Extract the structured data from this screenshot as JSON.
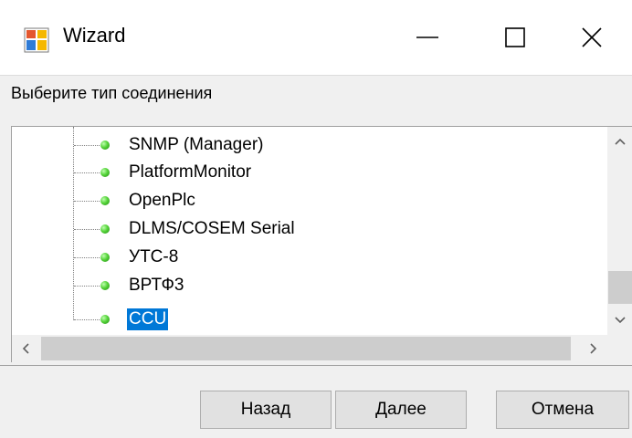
{
  "window": {
    "title": "Wizard"
  },
  "instruction": "Выберите тип соединения",
  "tree": {
    "items": [
      {
        "label": "SNMP (Manager)",
        "selected": false
      },
      {
        "label": "PlatformMonitor",
        "selected": false
      },
      {
        "label": "OpenPlc",
        "selected": false
      },
      {
        "label": "DLMS/COSEM Serial",
        "selected": false
      },
      {
        "label": "УТС-8",
        "selected": false
      },
      {
        "label": "ВРТФ3",
        "selected": false
      },
      {
        "label": "CCU",
        "selected": true
      }
    ]
  },
  "buttons": {
    "back": "Назад",
    "next": "Далее",
    "cancel": "Отмена"
  },
  "colors": {
    "selection": "#0078d7",
    "node": "#56d43a"
  }
}
